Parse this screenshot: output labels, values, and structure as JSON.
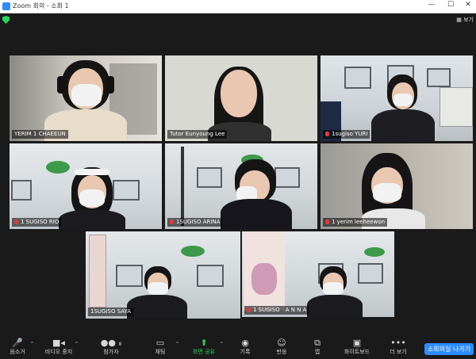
{
  "window": {
    "title": "Zoom 회의 - 소회 1",
    "controls": [
      "—",
      "☐",
      "✕"
    ]
  },
  "view_button": "보기",
  "accent": "#2d8cff",
  "participants": [
    {
      "name": "YERIM 1 CHAEEUN",
      "muted": false
    },
    {
      "name": "Tutor Eunyoung Lee",
      "muted": false
    },
    {
      "name": "1sugiso YURI",
      "muted": true
    },
    {
      "name": "1 SUGISO RIO",
      "muted": true
    },
    {
      "name": "1SUGISO ARINA",
      "muted": true
    },
    {
      "name": "1 yerim leeheewon",
      "muted": true
    },
    {
      "name": "1SUGISO SAYA",
      "muted": false,
      "active_speaker": true
    },
    {
      "name": "1 SUGISO　A N N A",
      "muted": true
    }
  ],
  "toolbar": {
    "mute": "음소거",
    "video": "비디오 중지",
    "participants": "참가자",
    "participants_count": "8",
    "chat": "채팅",
    "share": "화면 공유",
    "record": "기록",
    "reactions": "반응",
    "apps": "앱",
    "whiteboard": "화이트보드",
    "more": "더 보기",
    "leave": "소회의실 나가기"
  }
}
